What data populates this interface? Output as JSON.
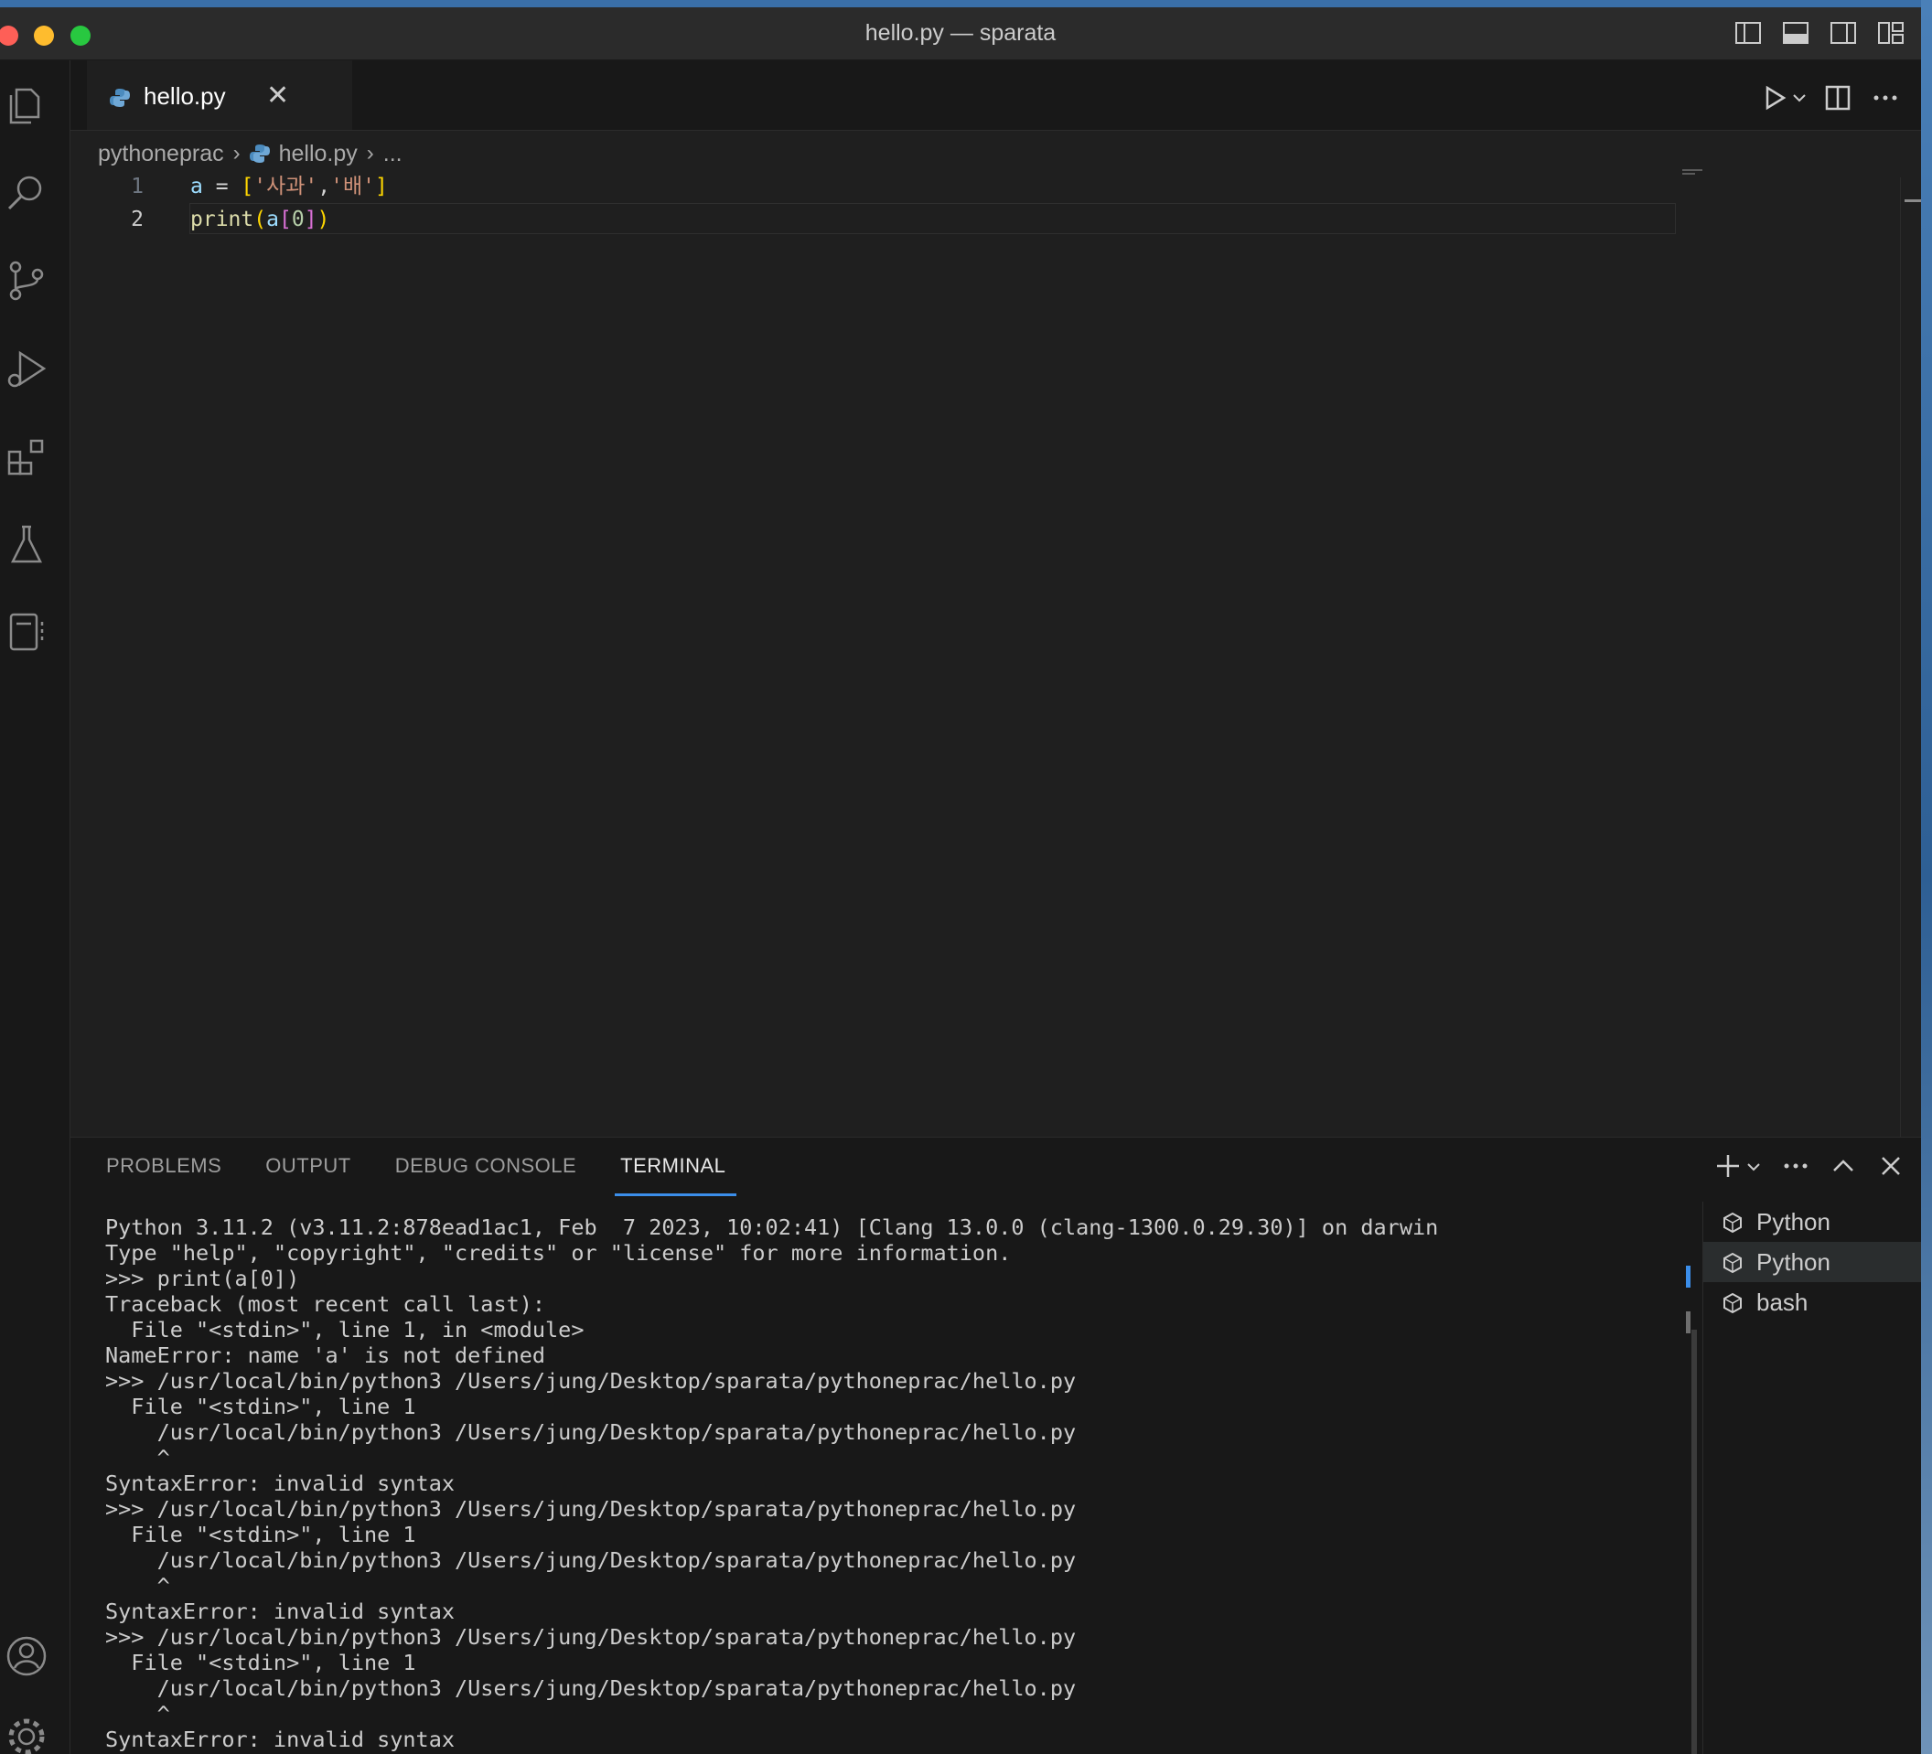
{
  "window": {
    "title": "hello.py — sparata"
  },
  "titlebar_icons": [
    "toggle-primary-sidebar-icon",
    "toggle-panel-icon",
    "toggle-secondary-sidebar-icon",
    "customize-layout-icon"
  ],
  "activity_bar": {
    "top": [
      "explorer-icon",
      "search-icon",
      "source-control-icon",
      "run-debug-icon",
      "extensions-icon",
      "testing-icon",
      "notebook-icon"
    ],
    "bottom": [
      "accounts-icon",
      "settings-gear-icon"
    ]
  },
  "tab": {
    "label": "hello.py",
    "close": "✕"
  },
  "editor_actions": [
    "run-icon",
    "chevron-down-icon",
    "split-editor-icon",
    "more-actions-icon"
  ],
  "breadcrumb": {
    "folder": "pythoneprac",
    "file": "hello.py",
    "more": "..."
  },
  "code": {
    "line_numbers": [
      "1",
      "2"
    ],
    "line1": {
      "var": "a",
      "op": " = ",
      "open": "[",
      "s1": "'사과'",
      "comma": ",",
      "s2": "'배'",
      "close": "]"
    },
    "line2": {
      "fn": "print",
      "open": "(",
      "var": "a",
      "iopen": "[",
      "num": "0",
      "iclose": "]",
      "close": ")"
    }
  },
  "panel": {
    "tabs": [
      "PROBLEMS",
      "OUTPUT",
      "DEBUG CONSOLE",
      "TERMINAL"
    ],
    "active_tab": "TERMINAL",
    "actions": [
      "new-terminal-icon",
      "chevron-down-icon",
      "more-actions-icon",
      "maximize-panel-icon",
      "close-panel-icon"
    ]
  },
  "terminal": {
    "lines": [
      "Python 3.11.2 (v3.11.2:878ead1ac1, Feb  7 2023, 10:02:41) [Clang 13.0.0 (clang-1300.0.29.30)] on darwin",
      "Type \"help\", \"copyright\", \"credits\" or \"license\" for more information.",
      ">>> print(a[0])",
      "Traceback (most recent call last):",
      "  File \"<stdin>\", line 1, in <module>",
      "NameError: name 'a' is not defined",
      ">>> /usr/local/bin/python3 /Users/jung/Desktop/sparata/pythoneprac/hello.py",
      "  File \"<stdin>\", line 1",
      "    /usr/local/bin/python3 /Users/jung/Desktop/sparata/pythoneprac/hello.py",
      "    ^",
      "SyntaxError: invalid syntax",
      ">>> /usr/local/bin/python3 /Users/jung/Desktop/sparata/pythoneprac/hello.py",
      "  File \"<stdin>\", line 1",
      "    /usr/local/bin/python3 /Users/jung/Desktop/sparata/pythoneprac/hello.py",
      "    ^",
      "SyntaxError: invalid syntax",
      ">>> /usr/local/bin/python3 /Users/jung/Desktop/sparata/pythoneprac/hello.py",
      "  File \"<stdin>\", line 1",
      "    /usr/local/bin/python3 /Users/jung/Desktop/sparata/pythoneprac/hello.py",
      "    ^",
      "SyntaxError: invalid syntax"
    ],
    "instances": [
      {
        "label": "Python",
        "selected": false
      },
      {
        "label": "Python",
        "selected": true
      },
      {
        "label": "bash",
        "selected": false
      }
    ]
  },
  "colors": {
    "accent": "#3b8eea",
    "editor_bg": "#1f1f1f",
    "panel_bg": "#181818"
  }
}
